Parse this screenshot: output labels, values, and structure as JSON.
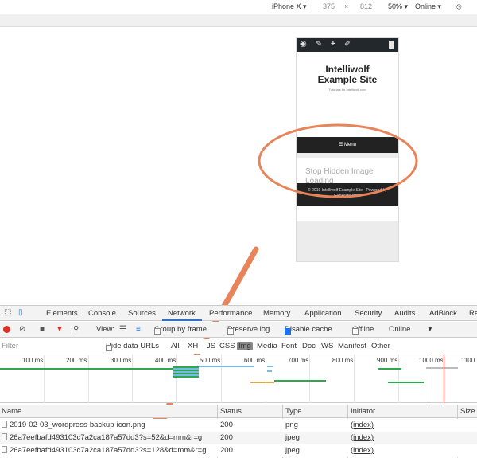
{
  "device_toolbar": {
    "device": "iPhone X",
    "width": "375",
    "separator": "×",
    "height": "812",
    "zoom": "50%",
    "network": "Online"
  },
  "phone": {
    "site_title_line1": "Intelliwolf",
    "site_title_line2": "Example Site",
    "tagline": "Tutorials for Intelliwolf.com",
    "menu_label": "☰ Menu",
    "content_text": "Stop Hidden Image Loading",
    "footer_line1": "© 2019 Intelliwolf Example Site · Powered by",
    "footer_line2": "GeneratePress"
  },
  "devtools": {
    "tabs": [
      "Elements",
      "Console",
      "Sources",
      "Network",
      "Performance",
      "Memory",
      "Application",
      "Security",
      "Audits",
      "AdBlock",
      "Re"
    ],
    "active_tab": "Network"
  },
  "network_toolbar": {
    "view_label": "View:",
    "group_by_frame": "Group by frame",
    "preserve_log": "Preserve log",
    "disable_cache": "Disable cache",
    "offline": "Offline",
    "throttle": "Online"
  },
  "filter_bar": {
    "placeholder": "Filter",
    "hide_data_urls": "Hide data URLs",
    "types": [
      "All",
      "XHR",
      "JS",
      "CSS",
      "Img",
      "Media",
      "Font",
      "Doc",
      "WS",
      "Manifest",
      "Other"
    ],
    "active_type": "Img"
  },
  "timeline": {
    "ticks": [
      "100 ms",
      "200 ms",
      "300 ms",
      "400 ms",
      "500 ms",
      "600 ms",
      "700 ms",
      "800 ms",
      "900 ms",
      "1000 ms",
      "1100"
    ]
  },
  "table": {
    "headers": [
      "Name",
      "Status",
      "Type",
      "Initiator",
      "Size"
    ],
    "rows": [
      {
        "name": "2019-02-03_wordpress-backup-icon.png",
        "status": "200",
        "type": "png",
        "initiator": "(index)"
      },
      {
        "name": "26a7eefbafd493103c7a2ca187a57dd3?s=52&d=mm&r=g",
        "status": "200",
        "type": "jpeg",
        "initiator": "(index)"
      },
      {
        "name": "26a7eefbafd493103c7a2ca187a57dd3?s=128&d=mm&r=g",
        "status": "200",
        "type": "jpeg",
        "initiator": "(index)"
      }
    ]
  },
  "colors": {
    "annotation": "#e8845a",
    "accent": "#1a73e8",
    "record": "#d93025"
  }
}
